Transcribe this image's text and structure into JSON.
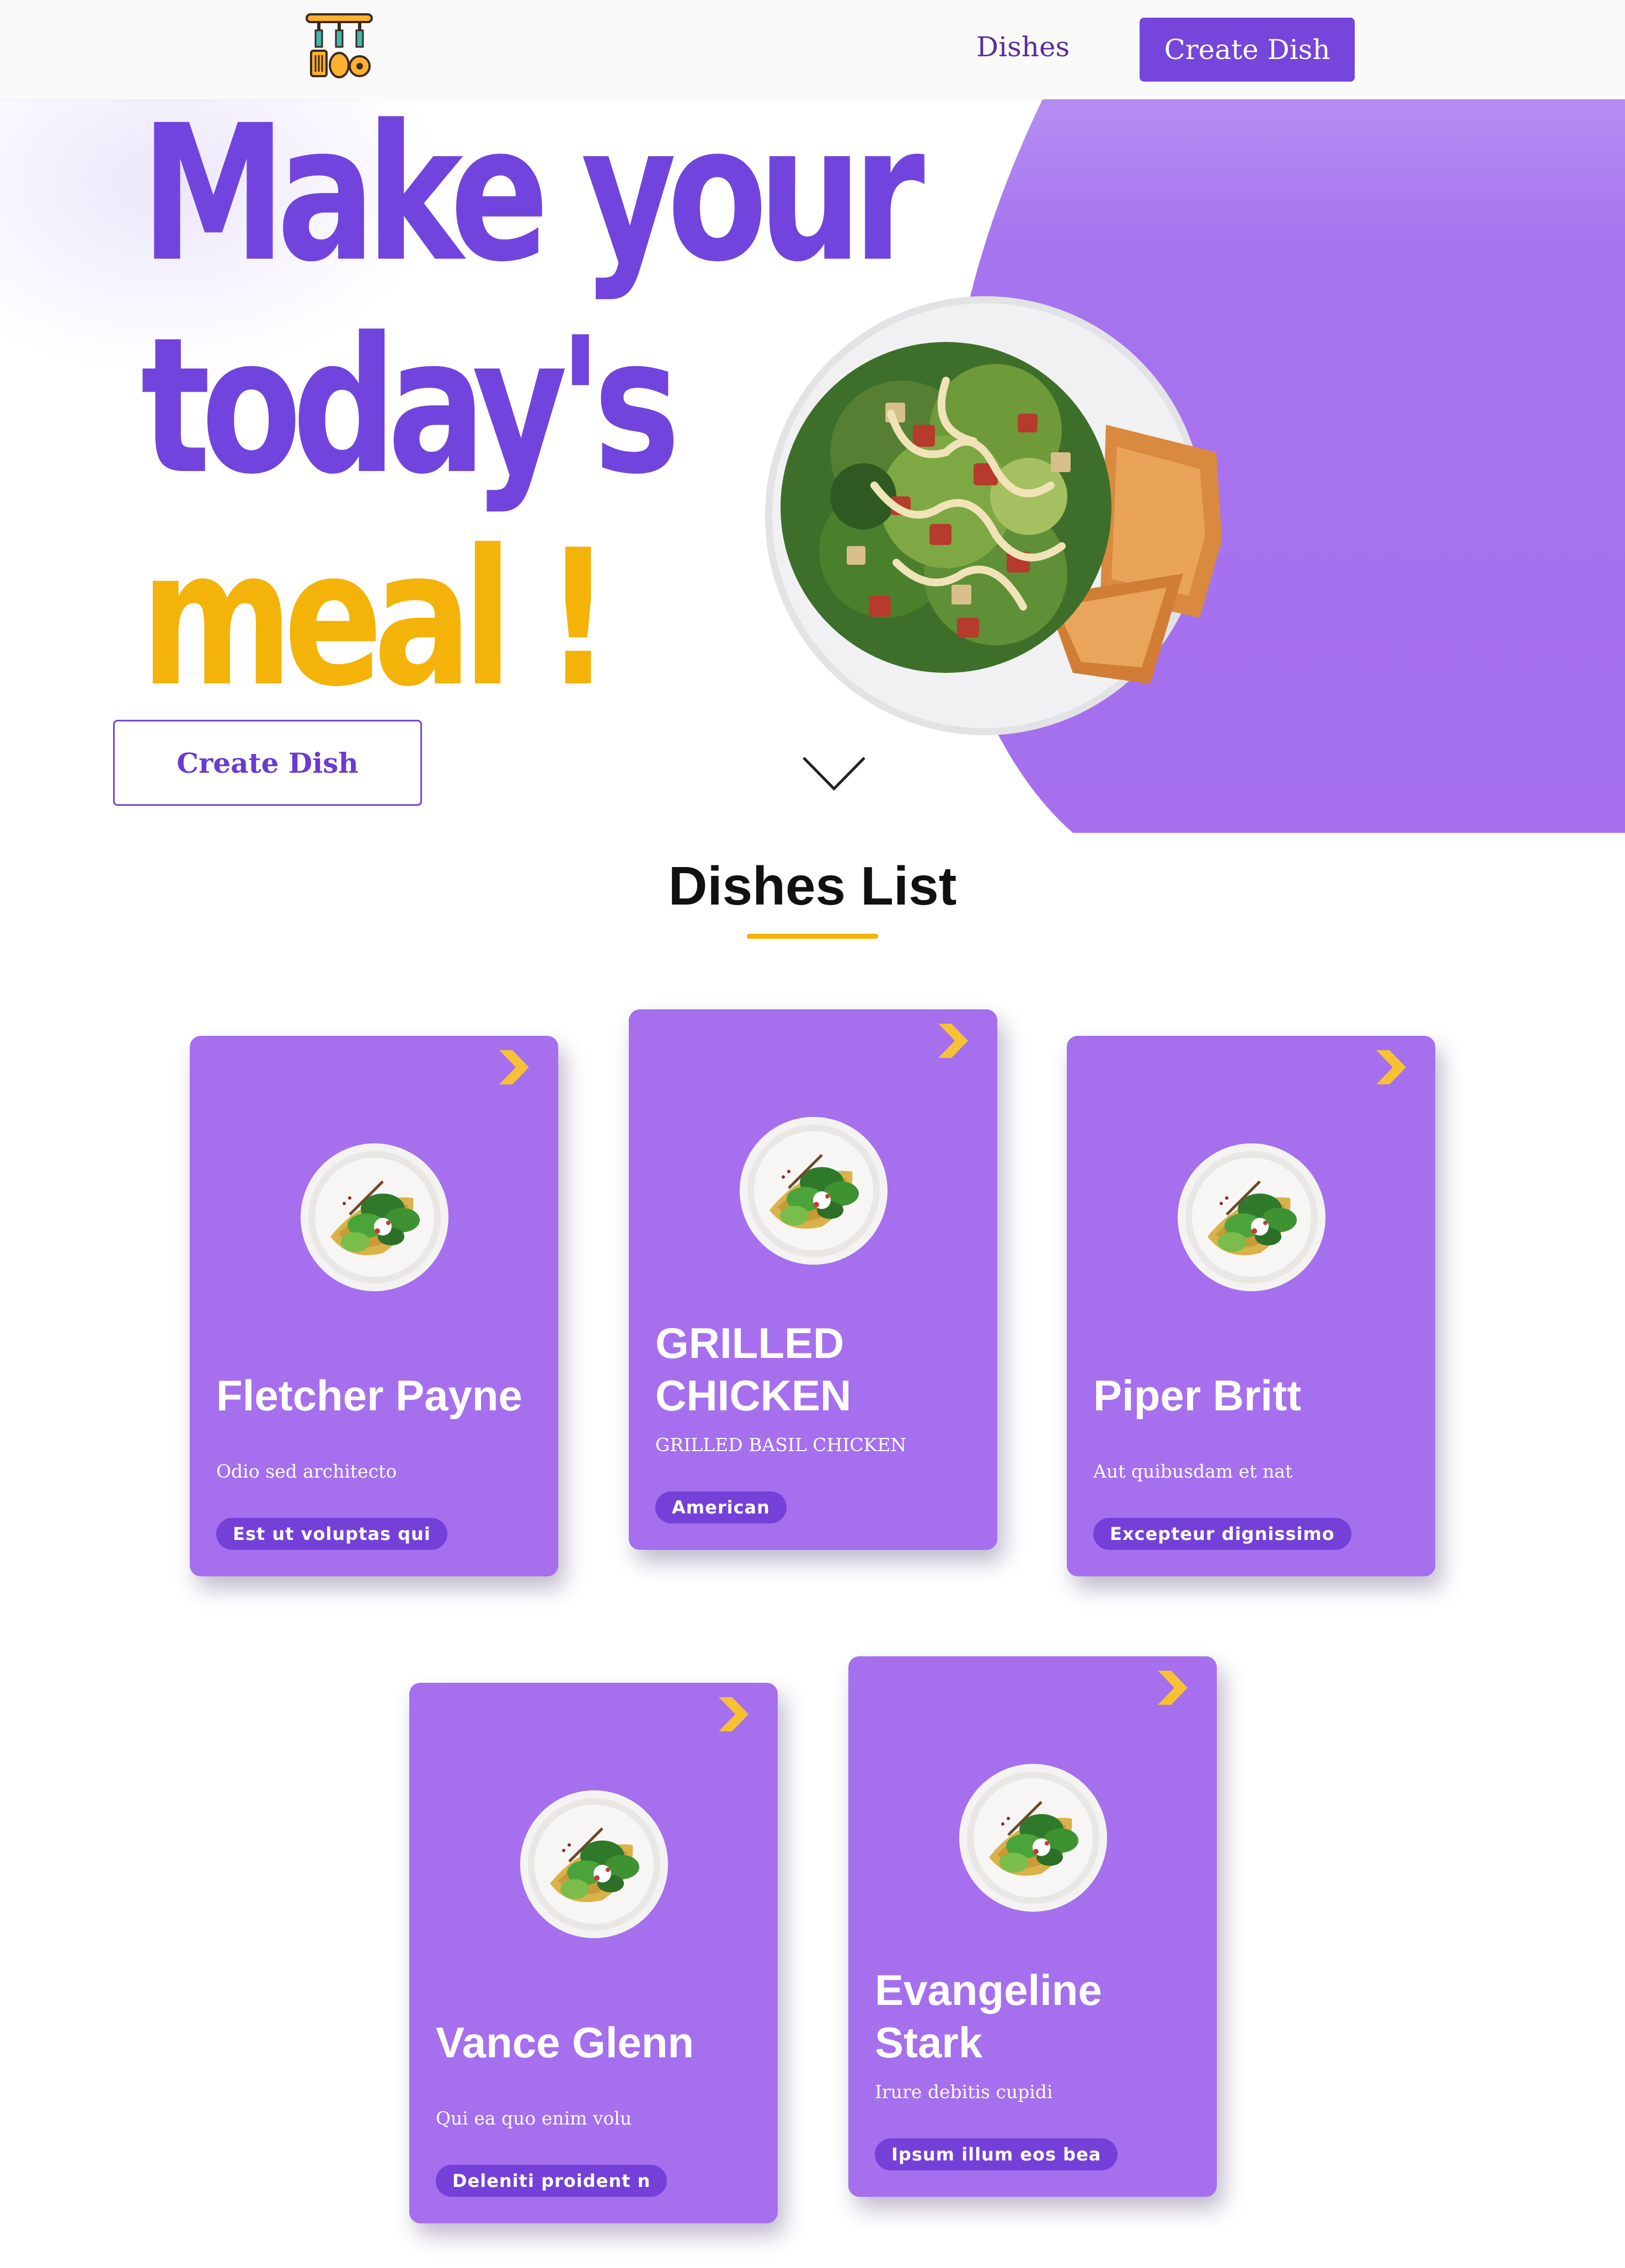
{
  "nav": {
    "logo_icon": "kitchen-utensils-icon",
    "dishes_link": "Dishes",
    "create_button": "Create Dish"
  },
  "hero": {
    "headline_line1": "Make your",
    "headline_line2": "today's",
    "headline_line3": "meal !",
    "create_button": "Create Dish",
    "scroll_icon": "chevron-down-icon",
    "accent_color": "#a56fee",
    "primary_color": "#7244de",
    "highlight_color": "#f4b308"
  },
  "dishes": {
    "title": "Dishes List",
    "items": [
      {
        "name": "Fletcher Payne",
        "description": "Odio sed architecto",
        "tag": "Est ut voluptas qui"
      },
      {
        "name": "GRILLED CHICKEN",
        "description": "GRILLED BASIL CHICKEN",
        "tag": "American"
      },
      {
        "name": "Piper Britt",
        "description": "Aut quibusdam et nat",
        "tag": "Excepteur dignissimo"
      },
      {
        "name": "Vance Glenn",
        "description": "Qui ea quo enim volu",
        "tag": "Deleniti proident n"
      },
      {
        "name": "Evangeline Stark",
        "description": "Irure debitis cupidi",
        "tag": "Ipsum illum eos bea"
      }
    ]
  }
}
